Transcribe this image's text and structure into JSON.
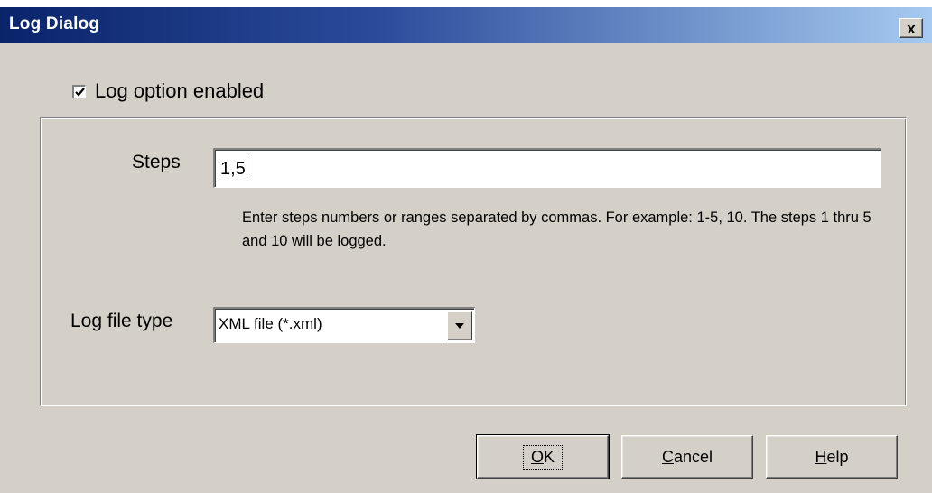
{
  "window": {
    "title": "Log Dialog",
    "close_label": "x"
  },
  "log_option": {
    "label": "Log option enabled",
    "checked": true
  },
  "steps": {
    "label": "Steps",
    "value": "1,5",
    "hint": "Enter steps numbers or ranges separated by commas. For example: 1-5, 10. The steps 1 thru 5 and 10 will be logged."
  },
  "log_file_type": {
    "label": "Log file type",
    "selected": "XML file (*.xml)"
  },
  "buttons": {
    "ok": {
      "first": "O",
      "rest": "K"
    },
    "cancel": {
      "first": "C",
      "rest": "ancel"
    },
    "help": {
      "first": "H",
      "rest": "elp"
    }
  },
  "colors": {
    "dialog_bg": "#d4d0c8",
    "titlebar_start": "#0a246a",
    "titlebar_end": "#a6caf0"
  }
}
